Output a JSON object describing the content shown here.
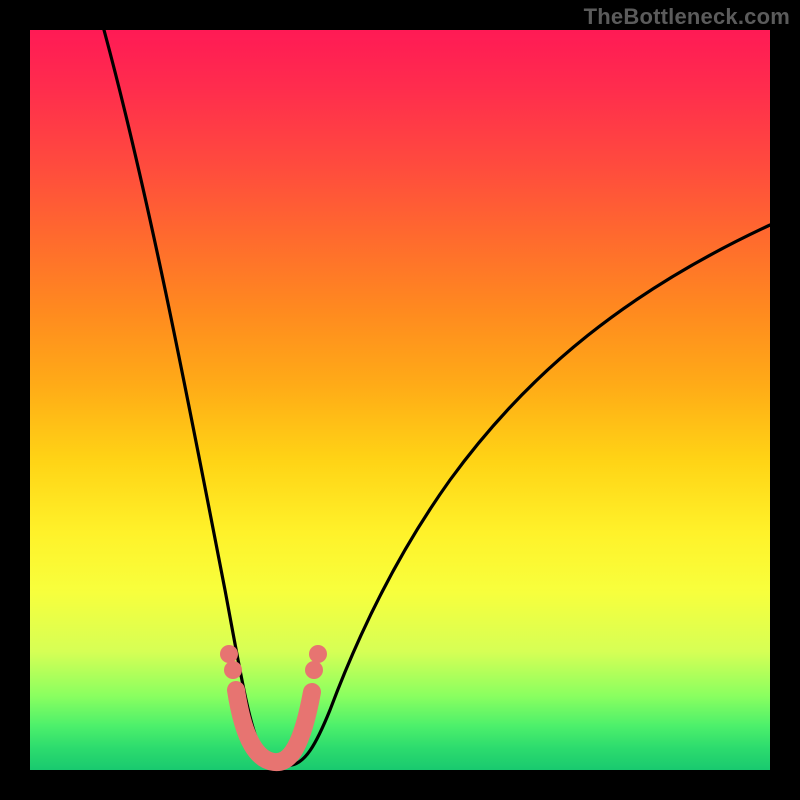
{
  "watermark": "TheBottleneck.com",
  "chart_data": {
    "type": "line",
    "title": "",
    "xlabel": "",
    "ylabel": "",
    "xlim": [
      0,
      100
    ],
    "ylim": [
      0,
      100
    ],
    "background_gradient": {
      "direction": "vertical",
      "stops": [
        {
          "pos": 0,
          "color": "#ff1a55"
        },
        {
          "pos": 18,
          "color": "#ff4a3e"
        },
        {
          "pos": 48,
          "color": "#ffab17"
        },
        {
          "pos": 68,
          "color": "#fff22a"
        },
        {
          "pos": 90,
          "color": "#8aff60"
        },
        {
          "pos": 100,
          "color": "#19c96f"
        }
      ]
    },
    "series": [
      {
        "name": "bottleneck-curve",
        "stroke": "#000000",
        "x": [
          10,
          12,
          14,
          16,
          18,
          20,
          22,
          24,
          26,
          28,
          30,
          32,
          34,
          36,
          38,
          40,
          44,
          48,
          52,
          56,
          60,
          64,
          68,
          72,
          76,
          80,
          84,
          88,
          92,
          96,
          100
        ],
        "y": [
          100,
          93,
          86,
          79,
          72,
          64,
          56,
          47,
          38,
          28,
          18,
          10,
          4,
          1,
          0,
          1,
          6,
          12,
          18,
          24,
          29,
          34,
          39,
          43,
          47,
          51,
          55,
          58,
          61,
          64,
          67
        ]
      },
      {
        "name": "highlight-markers",
        "stroke": "#e77471",
        "marker": "circle",
        "x": [
          27,
          27.5,
          29,
          31,
          33,
          35,
          37,
          38,
          38.5
        ],
        "y": [
          15,
          13,
          5,
          2.5,
          2,
          2,
          2.5,
          11,
          13
        ]
      }
    ]
  }
}
